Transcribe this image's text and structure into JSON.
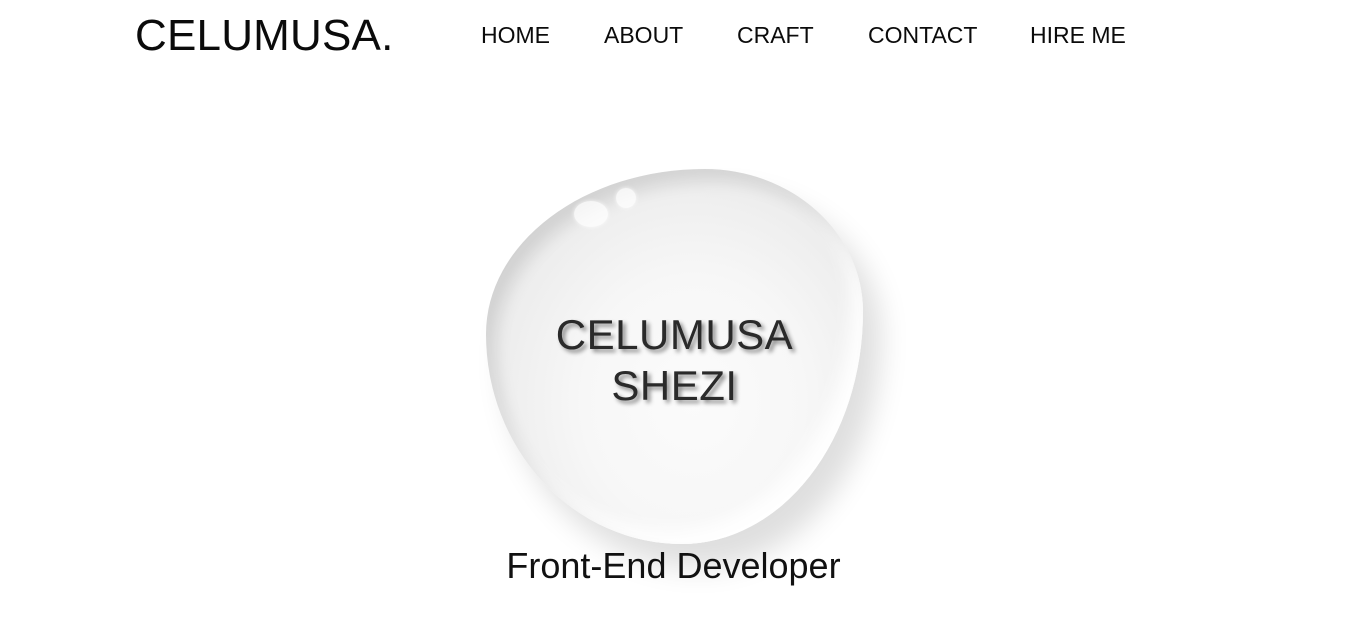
{
  "header": {
    "logo": "CELUMUSA.",
    "nav": [
      {
        "label": "HOME"
      },
      {
        "label": "ABOUT"
      },
      {
        "label": "CRAFT"
      },
      {
        "label": "CONTACT"
      },
      {
        "label": "HIRE ME"
      }
    ]
  },
  "hero": {
    "name_line_1": "CELUMUSA",
    "name_line_2": "SHEZI",
    "role": "Front-End Developer"
  },
  "colors": {
    "text": "#111111",
    "background": "#ffffff",
    "drop_highlight": "#fbfbfb",
    "drop_shadow": "#dedede"
  }
}
